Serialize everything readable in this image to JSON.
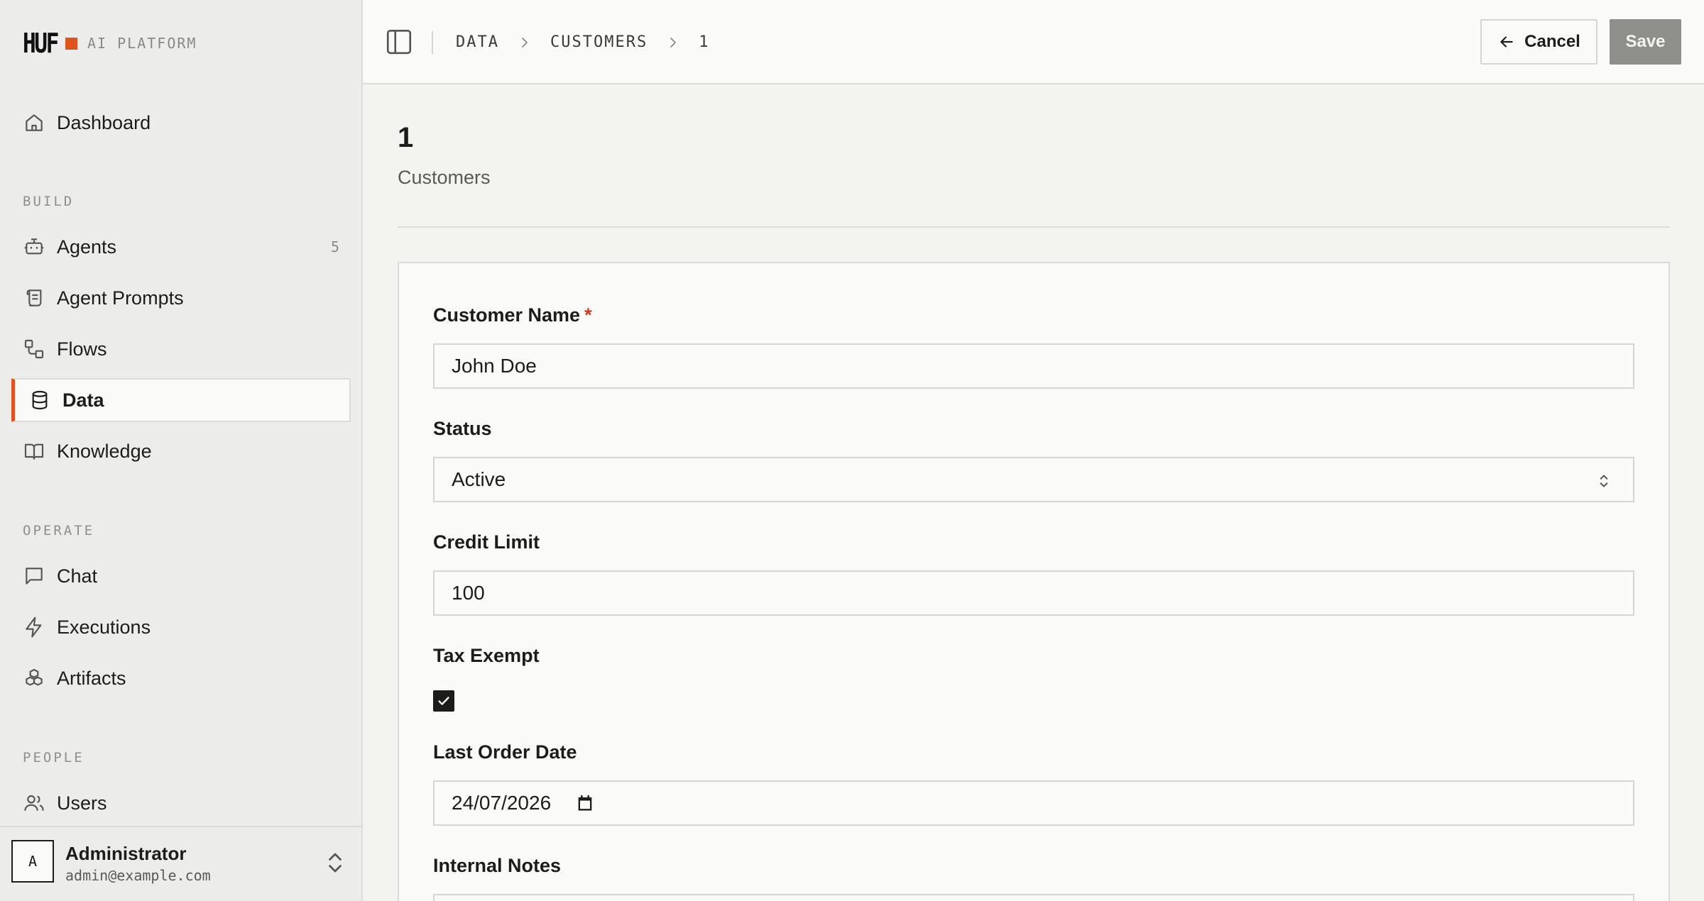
{
  "brand": {
    "logo": "HUF",
    "subtitle": "AI PLATFORM",
    "accent": "#e0521f"
  },
  "sidebar": {
    "dashboard": {
      "label": "Dashboard",
      "icon": "home-icon"
    },
    "sections": {
      "build": "BUILD",
      "operate": "OPERATE",
      "people": "PEOPLE"
    },
    "build_items": [
      {
        "label": "Agents",
        "icon": "bot-icon",
        "count": "5"
      },
      {
        "label": "Agent Prompts",
        "icon": "scroll-icon"
      },
      {
        "label": "Flows",
        "icon": "flow-icon"
      },
      {
        "label": "Data",
        "icon": "database-icon",
        "active": true
      },
      {
        "label": "Knowledge",
        "icon": "book-icon"
      }
    ],
    "operate_items": [
      {
        "label": "Chat",
        "icon": "chat-icon"
      },
      {
        "label": "Executions",
        "icon": "bolt-icon"
      },
      {
        "label": "Artifacts",
        "icon": "boxes-icon"
      }
    ],
    "people_items": [
      {
        "label": "Users",
        "icon": "users-icon"
      }
    ],
    "user": {
      "initial": "A",
      "name": "Administrator",
      "email": "admin@example.com"
    }
  },
  "topbar": {
    "breadcrumb": [
      "DATA",
      "CUSTOMERS",
      "1"
    ],
    "cancel_label": "Cancel",
    "save_label": "Save"
  },
  "page": {
    "title": "1",
    "subtitle": "Customers"
  },
  "form": {
    "customer_name": {
      "label": "Customer Name",
      "required_mark": "*",
      "value": "John Doe"
    },
    "status": {
      "label": "Status",
      "value": "Active"
    },
    "credit_limit": {
      "label": "Credit Limit",
      "value": "100"
    },
    "tax_exempt": {
      "label": "Tax Exempt",
      "checked": true
    },
    "last_order_date": {
      "label": "Last Order Date",
      "value": "24/07/2026"
    },
    "internal_notes": {
      "label": "Internal Notes",
      "value": ""
    }
  }
}
